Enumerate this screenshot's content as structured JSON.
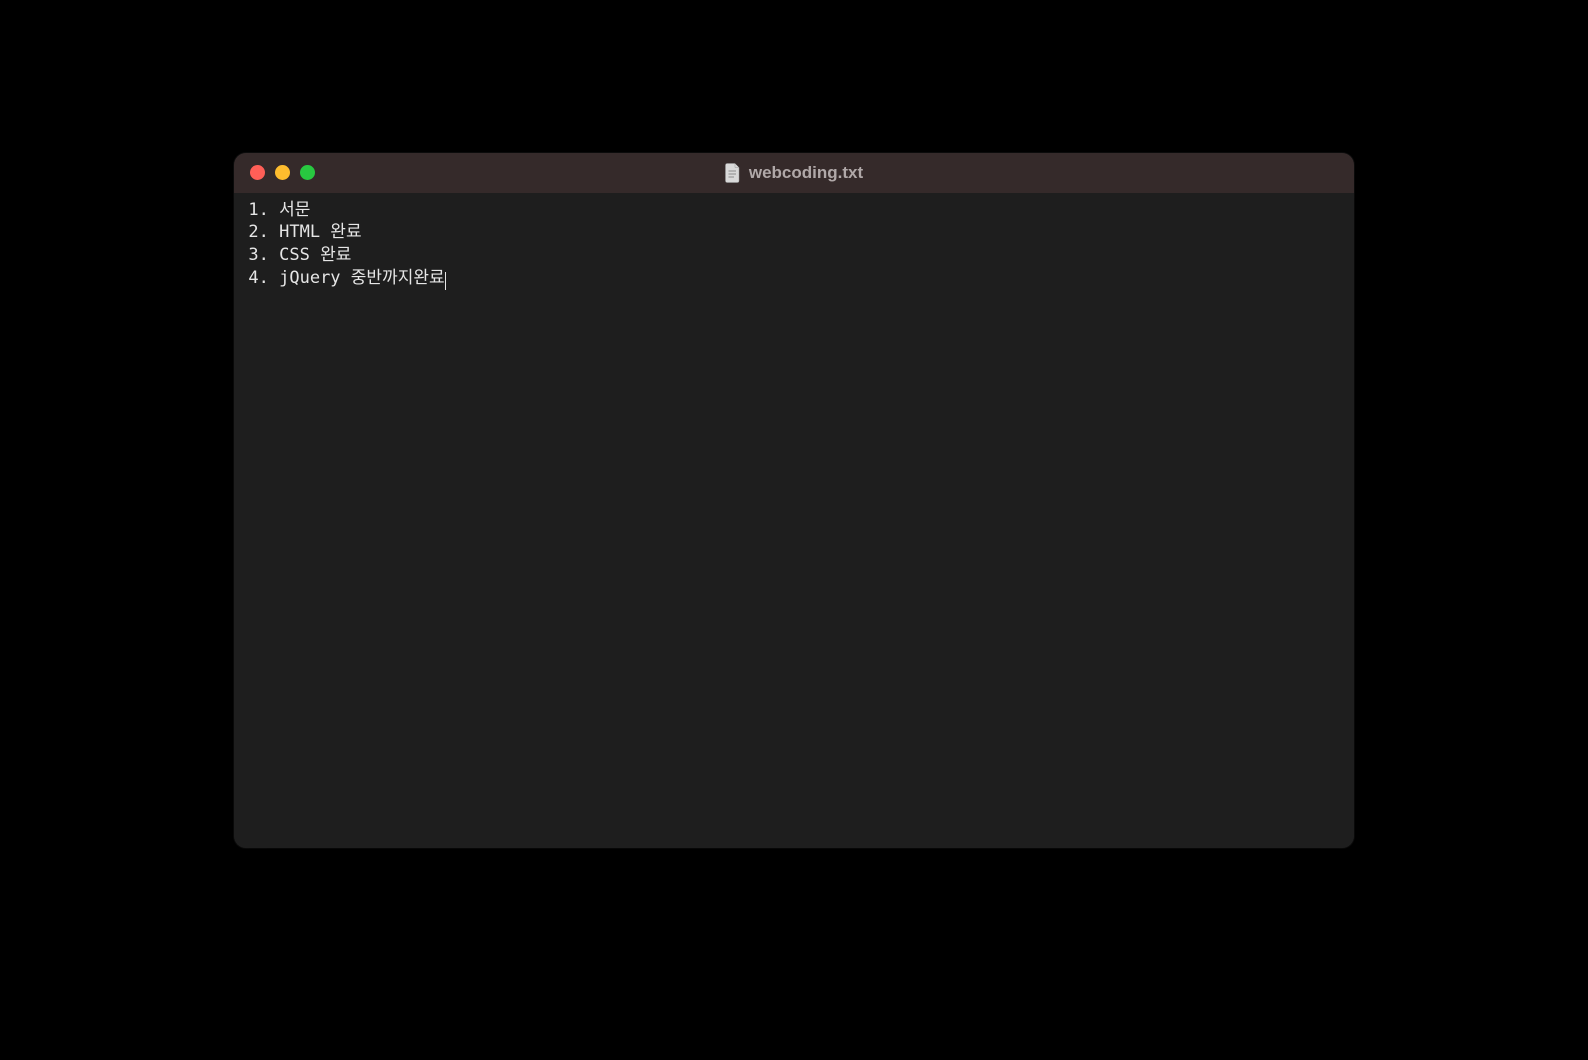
{
  "titlebar": {
    "filename": "webcoding.txt"
  },
  "editor": {
    "lines": [
      {
        "num": "1.",
        "text": "서문"
      },
      {
        "num": "2.",
        "text": "HTML 완료"
      },
      {
        "num": "3.",
        "text": "CSS 완료"
      },
      {
        "num": "4.",
        "text": "jQuery 중반까지완료"
      }
    ],
    "cursor_on_line": 3
  }
}
